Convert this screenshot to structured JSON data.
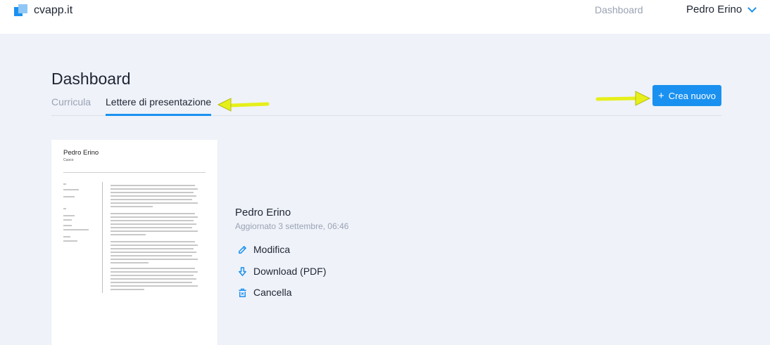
{
  "header": {
    "logo_text": "cvapp.it",
    "nav_dashboard": "Dashboard",
    "user_name": "Pedro Erino"
  },
  "page": {
    "title": "Dashboard",
    "tabs": [
      {
        "label": "Curricula",
        "active": false
      },
      {
        "label": "Lettere di presentazione",
        "active": true
      }
    ],
    "create_button": {
      "icon": "+",
      "label": "Crea nuovo"
    }
  },
  "document": {
    "thumbnail": {
      "name": "Pedro Erino",
      "role": "Cuoco"
    },
    "title": "Pedro Erino",
    "updated": "Aggiornato 3 settembre, 06:46",
    "actions": [
      {
        "icon": "pencil-icon",
        "label": "Modifica"
      },
      {
        "icon": "download-icon",
        "label": "Download (PDF)"
      },
      {
        "icon": "trash-icon",
        "label": "Cancella"
      }
    ]
  },
  "colors": {
    "accent": "#1a91f0",
    "background": "#eff2f9",
    "annotation_arrow": "#e6ef1a"
  }
}
